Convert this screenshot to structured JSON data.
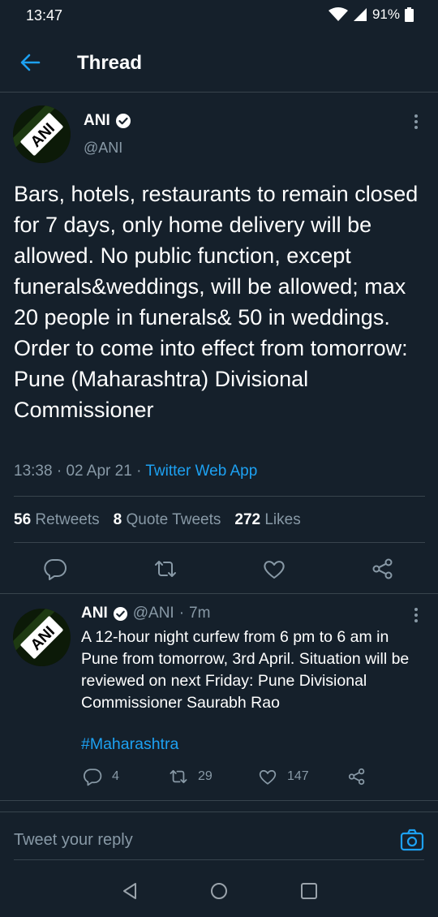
{
  "status_bar": {
    "time": "13:47",
    "battery": "91%"
  },
  "header": {
    "title": "Thread"
  },
  "main_tweet": {
    "author_name": "ANI",
    "author_handle": "@ANI",
    "avatar_text": "ANI",
    "text": "Bars, hotels, restaurants to remain closed for 7 days, only home delivery will be allowed. No public function, except funerals&weddings, will be allowed; max 20 people in funerals& 50 in weddings. Order to come into effect from tomorrow: Pune (Maharashtra) Divisional Commissioner",
    "time": "13:38",
    "date": "02 Apr 21",
    "source": "Twitter Web App",
    "retweets_count": "56",
    "retweets_label": "Retweets",
    "quotes_count": "8",
    "quotes_label": "Quote Tweets",
    "likes_count": "272",
    "likes_label": "Likes"
  },
  "reply_tweet": {
    "author_name": "ANI",
    "author_handle": "@ANI",
    "elapsed": "7m",
    "avatar_text": "ANI",
    "text": "A 12-hour night curfew from 6 pm to 6 am in Pune from tomorrow, 3rd April. Situation will be reviewed on next Friday: Pune Divisional Commissioner Saurabh Rao",
    "hashtag": "#Maharashtra",
    "replies": "4",
    "retweets": "29",
    "likes": "147"
  },
  "composer": {
    "placeholder": "Tweet your reply"
  },
  "colors": {
    "background": "#15202b",
    "accent": "#1da1f2",
    "muted": "#8899a6",
    "divider": "#38444d"
  },
  "icons": [
    "back-arrow-icon",
    "verified-badge-icon",
    "more-options-icon",
    "reply-icon",
    "retweet-icon",
    "like-icon",
    "share-icon",
    "camera-icon",
    "wifi-icon",
    "signal-icon",
    "battery-icon"
  ]
}
